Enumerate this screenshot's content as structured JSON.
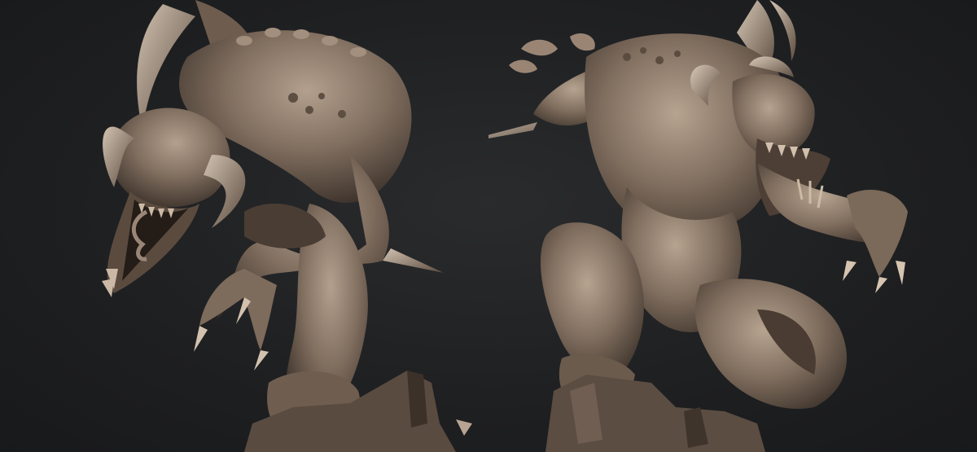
{
  "scene": {
    "background_color": "#1f2022",
    "sculpt_color": "#8a7868",
    "sculpt_shadow": "#3f352d",
    "sculpt_highlight": "#b9a593",
    "subject_left": "creature-sculpt-side-view",
    "subject_right": "creature-sculpt-front-view"
  }
}
